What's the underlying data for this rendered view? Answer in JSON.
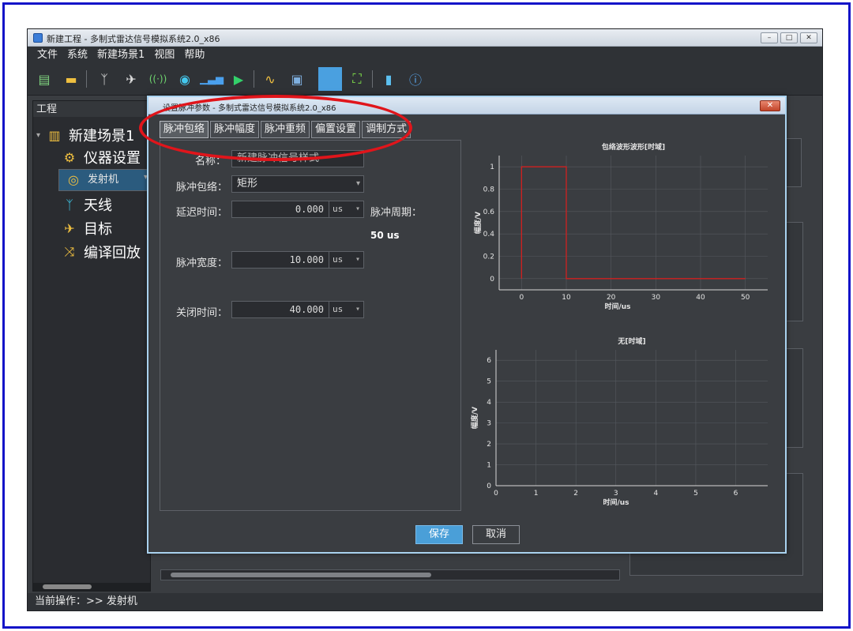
{
  "window": {
    "title": "新建工程 - 多制式雷达信号模拟系统2.0_x86",
    "btn_min": "–",
    "btn_max": "□",
    "btn_close": "✕"
  },
  "menu": [
    "文件",
    "系统",
    "新建场景1",
    "视图",
    "帮助"
  ],
  "toolbar_icons": [
    "new-file-icon",
    "open-folder-icon",
    "antenna-icon",
    "aircraft-icon",
    "signal-wave-icon",
    "radiation-icon",
    "spectrum-icon",
    "play-icon",
    "waveform-icon",
    "device-icon",
    "blank-icon",
    "fit-view-icon",
    "book-icon",
    "info-icon"
  ],
  "left_panel": {
    "header": "工程",
    "root": "新建场景1",
    "items": [
      "仪器设置",
      "发射机",
      "天线",
      "目标",
      "编译回放"
    ],
    "selected": "发射机"
  },
  "status": "当前操作：>> 发射机",
  "dialog": {
    "title": "设置脉冲参数 - 多制式雷达信号模拟系统2.0_x86",
    "tabs": [
      "脉冲包络",
      "脉冲幅度",
      "脉冲重频",
      "偏置设置",
      "调制方式"
    ],
    "active_tab": "脉冲包络",
    "name_label": "名称：",
    "name_value": "新建脉冲信号样式",
    "envelope_label": "脉冲包络：",
    "envelope_value": "矩形",
    "delay_label": "延迟时间：",
    "delay_value": "0.000",
    "delay_unit": "us",
    "period_label": "脉冲周期：",
    "period_value": "50 us",
    "width_label": "脉冲宽度：",
    "width_value": "10.000",
    "width_unit": "us",
    "off_label": "关闭时间：",
    "off_value": "40.000",
    "off_unit": "us",
    "save": "保存",
    "cancel": "取消"
  },
  "chart_data": [
    {
      "type": "line",
      "title": "包络波形波形[时域]",
      "xlabel": "时间/us",
      "ylabel": "幅度/V",
      "xlim": [
        -5,
        55
      ],
      "ylim": [
        -0.1,
        1.1
      ],
      "xticks": [
        0,
        10,
        20,
        30,
        40,
        50
      ],
      "yticks": [
        0,
        0.2,
        0.4,
        0.6,
        0.8,
        1
      ],
      "series": [
        {
          "x": [
            0,
            0,
            10,
            10,
            50
          ],
          "y": [
            0,
            1,
            1,
            0,
            0
          ],
          "color": "#d02020"
        }
      ],
      "grid": true
    },
    {
      "type": "line",
      "title": "无[时域]",
      "xlabel": "时间/us",
      "ylabel": "幅度/V",
      "xlim": [
        0,
        6.8
      ],
      "ylim": [
        0,
        6.5
      ],
      "xticks": [
        0,
        1,
        2,
        3,
        4,
        5,
        6
      ],
      "yticks": [
        0,
        1,
        2,
        3,
        4,
        5,
        6
      ],
      "series": [],
      "grid": true
    }
  ]
}
